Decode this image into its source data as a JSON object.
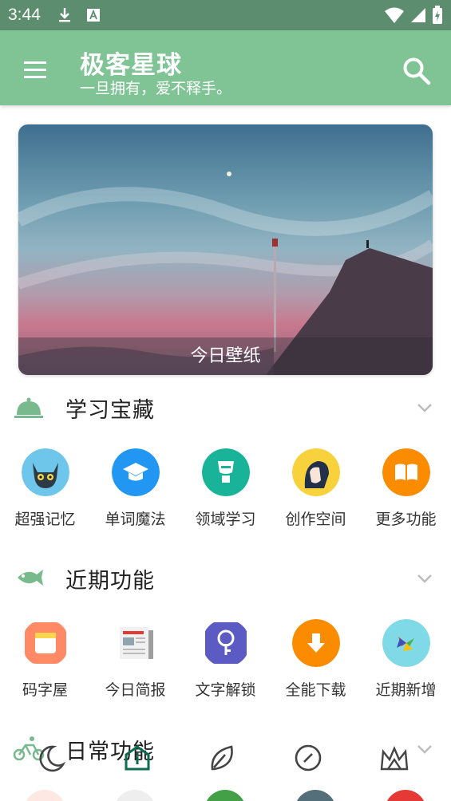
{
  "status_bar": {
    "time": "3:44"
  },
  "app_bar": {
    "title": "极客星球",
    "subtitle": "一旦拥有，爱不释手。"
  },
  "banner": {
    "caption": "今日壁纸"
  },
  "sections": [
    {
      "title": "学习宝藏",
      "items": [
        {
          "label": "超强记忆",
          "color": "#6ec6ea"
        },
        {
          "label": "单词魔法",
          "color": "#2196f3"
        },
        {
          "label": "领域学习",
          "color": "#19b39a"
        },
        {
          "label": "创作空间",
          "color": "#f7d23c"
        },
        {
          "label": "更多功能",
          "color": "#fb8c00"
        }
      ]
    },
    {
      "title": "近期功能",
      "items": [
        {
          "label": "码字屋",
          "color": "#ff8a65"
        },
        {
          "label": "今日简报",
          "color": "#eeeeee"
        },
        {
          "label": "文字解锁",
          "color": "#5c5bc4"
        },
        {
          "label": "全能下载",
          "color": "#fb8c00"
        },
        {
          "label": "近期新增",
          "color": "#7fd9e6"
        }
      ]
    },
    {
      "title": "日常功能"
    }
  ],
  "colors": {
    "status_bar": "#5c8d6e",
    "app_bar": "#80c496",
    "accent_green": "#79b98e",
    "nav_active": "#0d6b4f"
  }
}
